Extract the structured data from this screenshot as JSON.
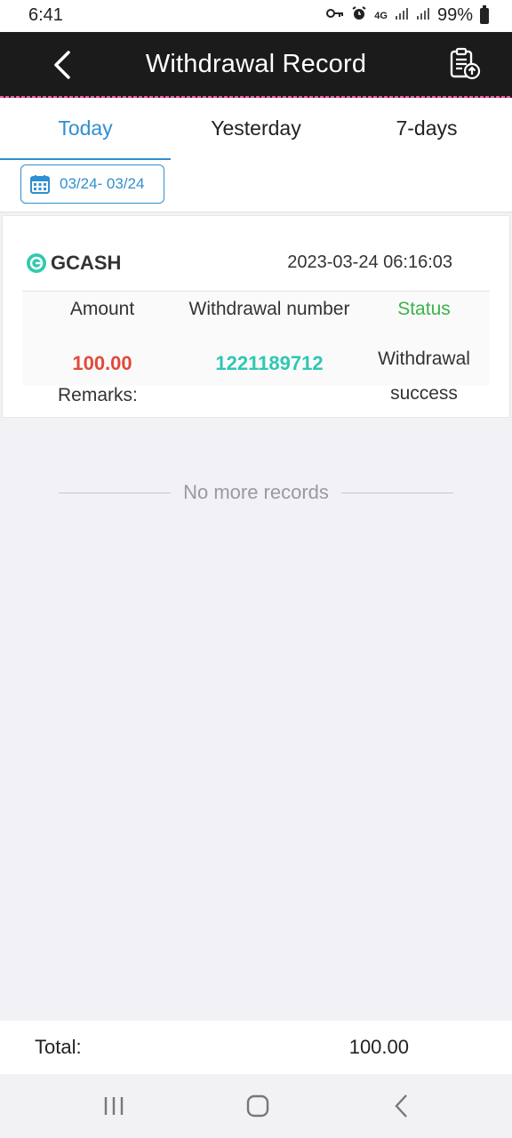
{
  "status_bar": {
    "time": "6:41",
    "network": "4G",
    "battery": "99%"
  },
  "header": {
    "title": "Withdrawal Record"
  },
  "tabs": [
    {
      "label": "Today",
      "active": true
    },
    {
      "label": "Yesterday",
      "active": false
    },
    {
      "label": "7-days",
      "active": false
    }
  ],
  "date_range": {
    "label": "03/24- 03/24"
  },
  "record": {
    "method": "GCASH",
    "datetime": "2023-03-24 06:16:03",
    "headers": {
      "amount": "Amount",
      "number": "Withdrawal number",
      "status": "Status"
    },
    "amount": "100.00",
    "number": "1221189712",
    "status_line1": "Withdrawal",
    "status_line2": "success",
    "remarks_label": "Remarks:"
  },
  "footer_note": "No more records",
  "total": {
    "label": "Total:",
    "value": "100.00"
  },
  "colors": {
    "accent": "#2f8fd0",
    "amount": "#e04a3a",
    "number": "#2ec7b5",
    "status_header": "#3bb34a"
  }
}
